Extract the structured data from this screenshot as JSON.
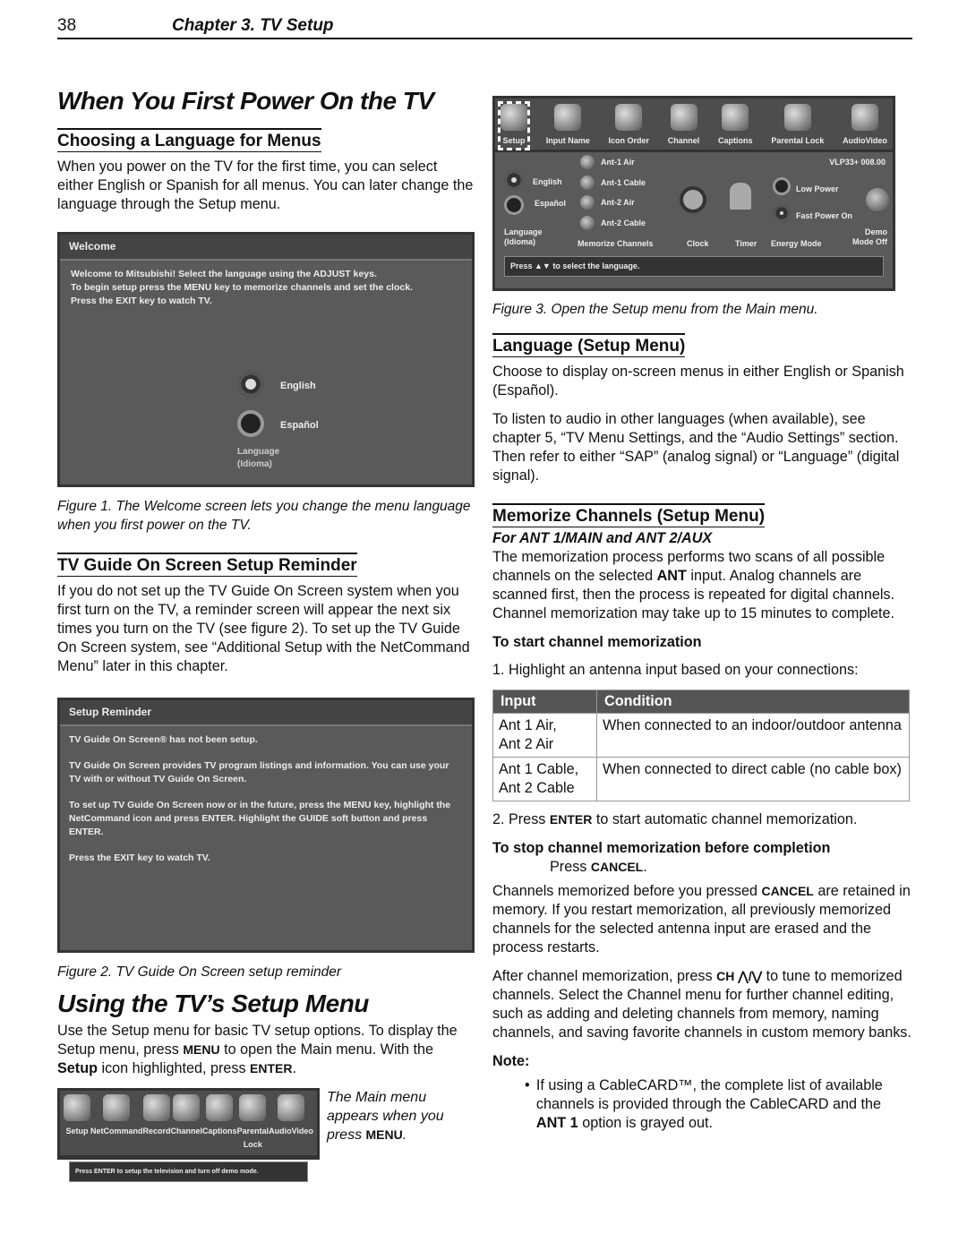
{
  "header": {
    "page_number": "38",
    "chapter": "Chapter 3.  TV Setup"
  },
  "left": {
    "title": "When You First Power On the TV",
    "lang_heading": "Choosing a Language for Menus",
    "lang_text": "When you power on the TV for the first time, you can select either English or Spanish for all menus.  You can later change the language through the Setup menu.",
    "fig1": {
      "bar": "Welcome",
      "msg": "Welcome to Mitsubishi!  Select the language using the ADJUST keys.\nTo begin setup press the MENU key to memorize channels and set the clock.\nPress the EXIT key to watch TV.",
      "english": "English",
      "espanol": "Español",
      "label1": "Language",
      "label2": "(Idioma)",
      "caption": "Figure 1.  The Welcome screen lets you change the menu language when you first power on the TV."
    },
    "guide_heading": "TV Guide On Screen Setup Reminder",
    "guide_text": "If you do not set up the TV Guide On Screen system when you first turn on the TV, a reminder screen will appear the next six times you turn on the TV (see figure 2).  To set up the TV Guide On Screen system, see “Additional Setup with the NetCommand Menu” later in this chapter.",
    "fig2": {
      "bar": "Setup Reminder",
      "l1": "TV Guide On Screen® has not been setup.",
      "l2": "TV Guide On Screen provides TV program listings and information.  You can use your TV with or without TV Guide On Screen.",
      "l3": "To set up TV Guide On Screen now or in the future, press the MENU key, highlight the NetCommand icon and press ENTER.  Highlight the GUIDE soft button and press ENTER.",
      "l4": "Press the EXIT key to watch TV.",
      "caption": "Figure 2. TV Guide On Screen setup reminder"
    },
    "setup_title": "Using the TV’s Setup Menu",
    "setup_text_a": "Use the Setup menu for basic TV setup options.  To display the Setup menu, press ",
    "setup_key1": "MENU",
    "setup_text_b": " to open the Main menu.  With the ",
    "setup_bold": "Setup",
    "setup_text_c": " icon highlighted, press ",
    "setup_key2": "ENTER",
    "main_menu": {
      "icons": [
        "Setup",
        "NetCommand",
        "Record",
        "Channel",
        "Captions",
        "Parental Lock",
        "AudioVideo"
      ],
      "msg": "Press ENTER to setup the television and turn off demo mode.",
      "caption_a": "The Main menu appears when you press ",
      "caption_key": "MENU"
    }
  },
  "right": {
    "fig3": {
      "icons": [
        "Setup",
        "Input Name",
        "Icon Order",
        "Channel",
        "Captions",
        "Parental Lock",
        "AudioVideo"
      ],
      "version": "VLP33+ 008.00",
      "english": "English",
      "espanol": "Español",
      "ants": [
        "Ant-1 Air",
        "Ant-1 Cable",
        "Ant-2 Air",
        "Ant-2 Cable"
      ],
      "low_power": "Low Power",
      "fast_power": "Fast Power On",
      "labels": [
        "Language\n(Idioma)",
        "Memorize Channels",
        "Clock",
        "Timer",
        "Energy Mode",
        "Demo\nMode Off"
      ],
      "msg": "Press ▲▼ to select the language.",
      "caption": "Figure 3. Open the Setup menu from the Main menu."
    },
    "lang_heading": "Language (Setup Menu)",
    "lang_p1": "Choose to display on-screen menus in either English or Spanish (Español).",
    "lang_p2": "To listen to audio in other languages (when available), see chapter 5, “TV Menu Settings, and the “Audio Settings” section.  Then refer to either “SAP” (analog signal) or “Language” (digital signal).",
    "mem_heading": "Memorize Channels (Setup Menu)",
    "mem_sub": "For ANT 1/MAIN and ANT 2/AUX",
    "mem_p_a": "The memorization process performs two scans of all possible channels on the selected ",
    "mem_p_ant": "ANT",
    "mem_p_b": " input.  Analog channels are scanned first, then the process is repeated for digital channels.  Channel memorization may take up to 15 minutes to complete.",
    "start_heading": "To start channel memorization",
    "step1": "1.  Highlight an antenna input based on your connections:",
    "table": {
      "headers": [
        "Input",
        "Condition"
      ],
      "rows": [
        [
          "Ant 1 Air,\nAnt 2 Air",
          "When connected to an indoor/outdoor antenna"
        ],
        [
          "Ant 1 Cable,\nAnt 2 Cable",
          "When connected to direct cable (no cable box)"
        ]
      ]
    },
    "step2_a": "2.  Press ",
    "step2_key": "ENTER",
    "step2_b": " to start automatic channel memorization.",
    "stop_heading": "To stop channel memorization before completion",
    "stop_a": "Press ",
    "stop_key": "CANCEL",
    "retained_a": "Channels memorized before you pressed ",
    "retained_key": "CANCEL",
    "retained_b": " are retained in memory.  If you restart memorization, all previously memorized channels for the selected antenna input are erased and the process restarts.",
    "after_a": "After channel memorization, press ",
    "after_key": "CH ⋀/⋁",
    "after_b": " to tune to memorized channels.  Select the Channel menu for further channel editing, such as adding and deleting channels from memory, naming channels, and saving favorite channels in custom memory banks.",
    "note_label": "Note:",
    "note_a": "If using a CableCARD™, the complete list of available channels is provided through the CableCARD and the ",
    "note_ant": "ANT 1",
    "note_b": " option is grayed out."
  }
}
